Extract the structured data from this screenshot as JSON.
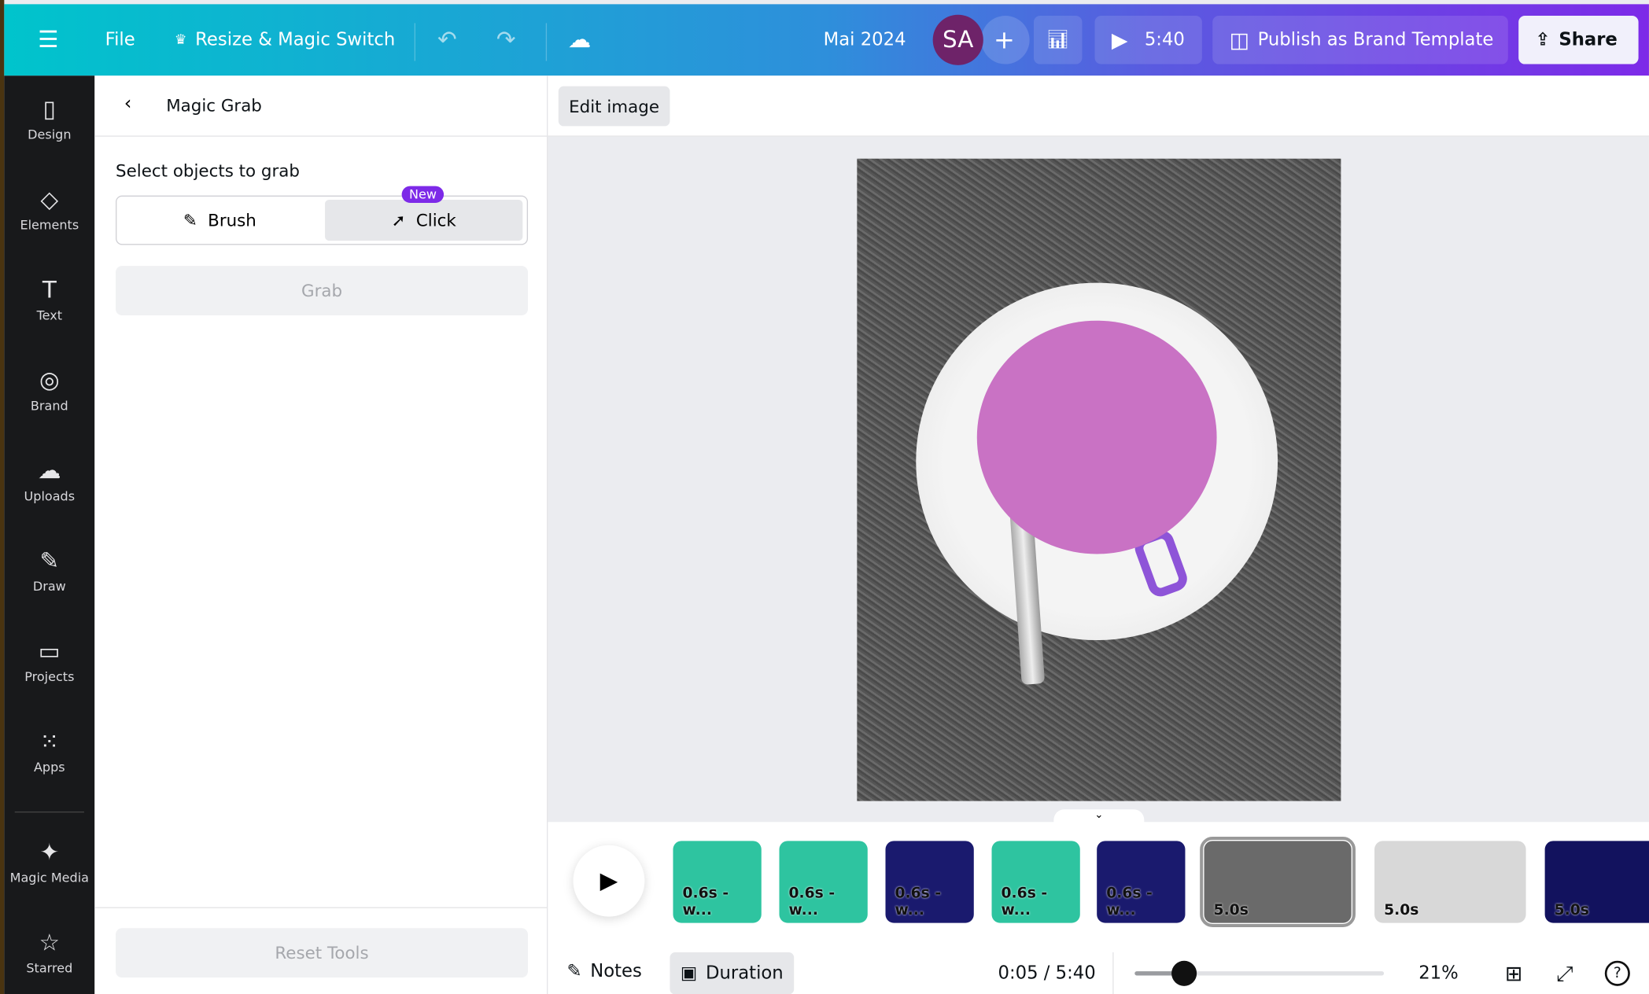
{
  "topbar": {
    "menu_icon": "hamburger-icon",
    "file": "File",
    "resize": "Resize & Magic Switch",
    "title": "Mai 2024",
    "avatar": "SA",
    "play_time": "5:40",
    "publish": "Publish as Brand Template",
    "share": "Share"
  },
  "sidebar": {
    "items": [
      {
        "label": "Design",
        "icon": "▯"
      },
      {
        "label": "Elements",
        "icon": "◇"
      },
      {
        "label": "Text",
        "icon": "T"
      },
      {
        "label": "Brand",
        "icon": "◎"
      },
      {
        "label": "Uploads",
        "icon": "☁"
      },
      {
        "label": "Draw",
        "icon": "✎"
      },
      {
        "label": "Projects",
        "icon": "▭"
      },
      {
        "label": "Apps",
        "icon": "⁙"
      },
      {
        "label": "Magic Media",
        "icon": "✦"
      },
      {
        "label": "Starred",
        "icon": "☆"
      }
    ]
  },
  "panel": {
    "title": "Magic Grab",
    "subtitle": "Select objects to grab",
    "brush": "Brush",
    "click": "Click",
    "new_badge": "New",
    "grab": "Grab",
    "reset": "Reset Tools"
  },
  "canvas": {
    "edit_image": "Edit image"
  },
  "timeline": {
    "thumbs": [
      {
        "label": "0.6s - w...",
        "color": "#2ec4a0"
      },
      {
        "label": "0.6s - w...",
        "color": "#2ec4a0"
      },
      {
        "label": "0.6s - w...",
        "color": "#1a1a6e"
      },
      {
        "label": "0.6s - w...",
        "color": "#2ec4a0"
      },
      {
        "label": "0.6s - w...",
        "color": "#1a1a6e"
      },
      {
        "label": "5.0s",
        "color": "#6a6a6a"
      },
      {
        "label": "5.0s",
        "color": "#d8d8d8"
      },
      {
        "label": "5.0s",
        "color": "#12125e"
      }
    ],
    "notes": "Notes",
    "duration": "Duration",
    "time": "0:05 / 5:40",
    "zoom": "21%",
    "zoom_fraction": 0.2
  }
}
